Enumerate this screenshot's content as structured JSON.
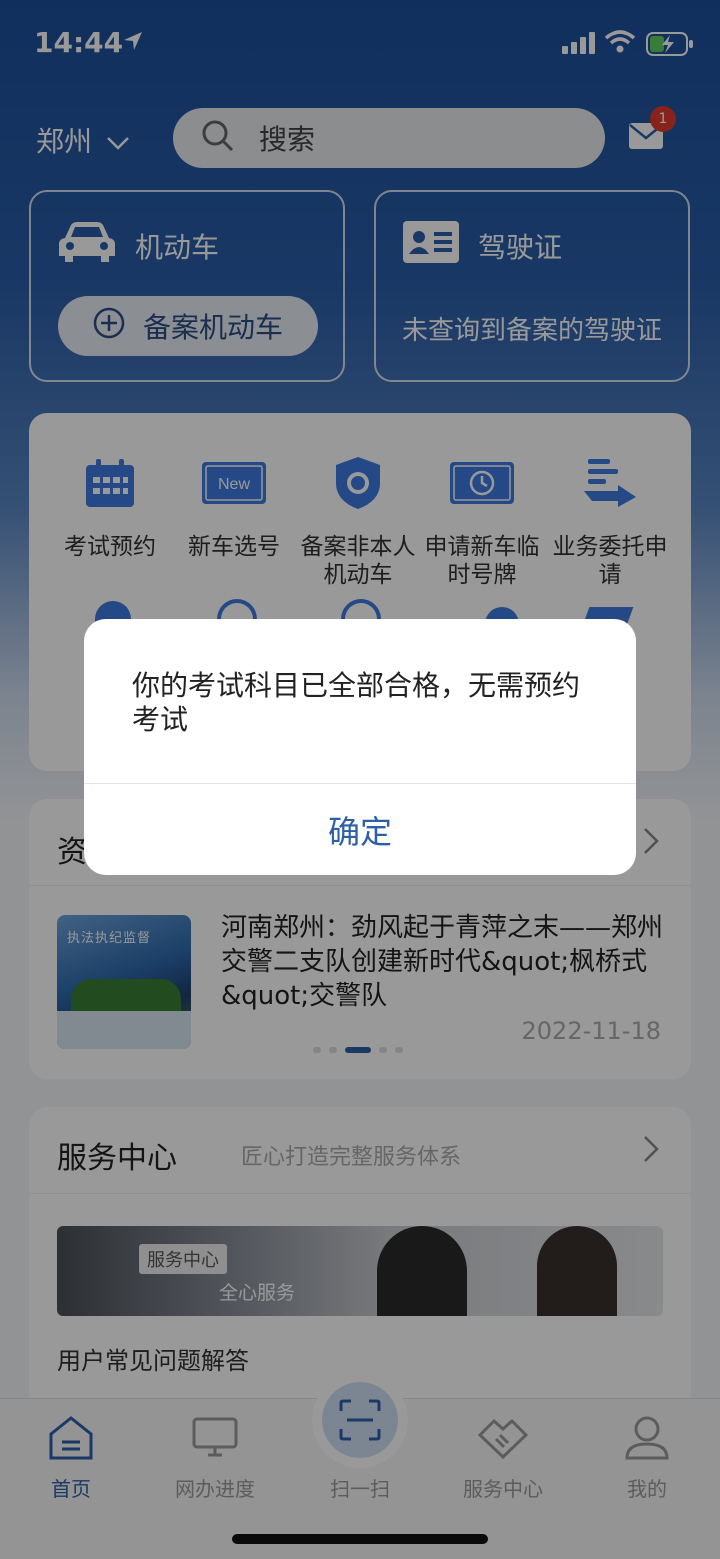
{
  "status_bar": {
    "time": "14:44"
  },
  "header": {
    "city": "郑州",
    "search_placeholder": "搜索",
    "mail_badge": "1"
  },
  "vehicle_card": {
    "title": "机动车",
    "button": "备案机动车"
  },
  "license_card": {
    "title": "驾驶证",
    "message": "未查询到备案的驾驶证"
  },
  "services": [
    {
      "label": "考试预约",
      "icon": "calendar-icon"
    },
    {
      "label": "新车选号",
      "icon": "new-plate-icon"
    },
    {
      "label": "备案非本人机动车",
      "icon": "shield-badge-icon"
    },
    {
      "label": "申请新车临时号牌",
      "icon": "temp-plate-icon"
    },
    {
      "label": "业务委托申请",
      "icon": "delegate-icon"
    }
  ],
  "news": {
    "section_title": "资",
    "headline": "河南郑州：劲风起于青萍之末——郑州交警二支队创建新时代&quot;枫桥式&quot;交警队",
    "date": "2022-11-18",
    "thumb_caption": "执法执纪监督"
  },
  "service_center": {
    "title": "服务中心",
    "subtitle": "匠心打造完整服务体系",
    "banner_tag": "服务中心",
    "banner_slogan": "全心服务",
    "faq": "用户常见问题解答"
  },
  "tabs": [
    {
      "label": "首页",
      "icon": "home-icon"
    },
    {
      "label": "网办进度",
      "icon": "monitor-icon"
    },
    {
      "label": "扫一扫",
      "icon": "scan-icon"
    },
    {
      "label": "服务中心",
      "icon": "handshake-icon"
    },
    {
      "label": "我的",
      "icon": "user-icon"
    }
  ],
  "dialog": {
    "message": "你的考试科目已全部合格，无需预约考试",
    "confirm": "确定"
  },
  "colors": {
    "primary": "#2c5fa8",
    "header_bg": "#1d4f9a",
    "badge": "#e23b2e"
  }
}
